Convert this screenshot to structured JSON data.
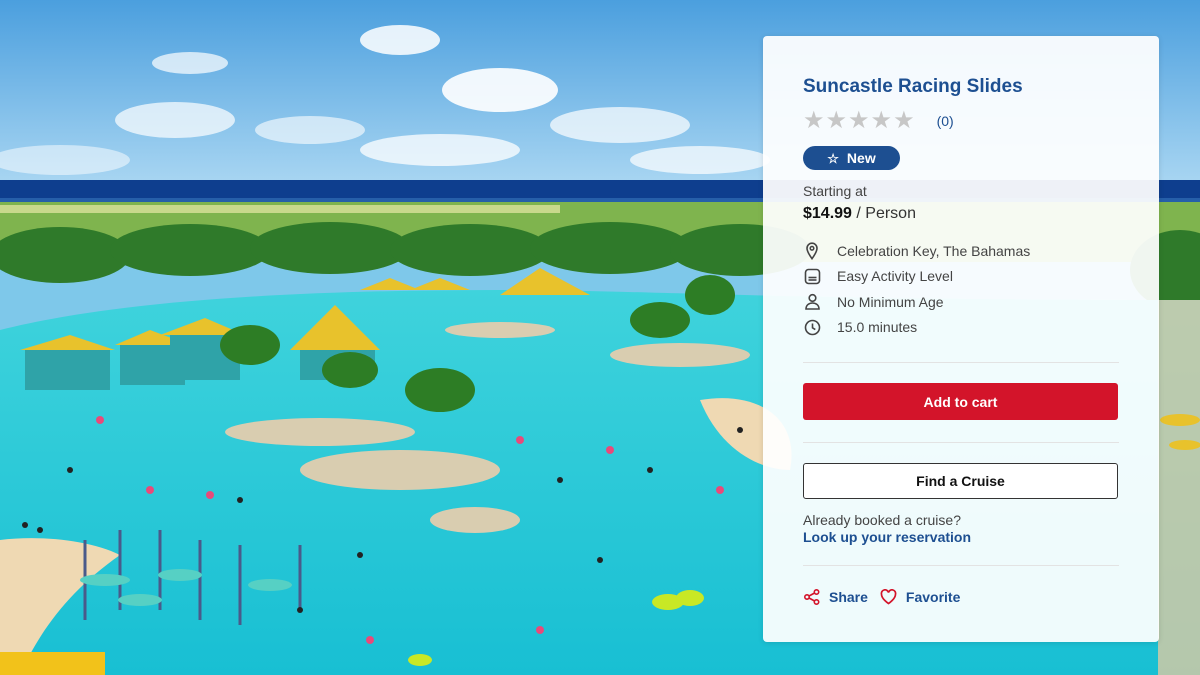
{
  "background": {
    "image": "resort-lagoon-image",
    "colors": {
      "sky": "#6fb6e6",
      "ocean": "#0d3a8a",
      "lagoon": "#2cc9d6",
      "sand": "#efd9b3"
    }
  },
  "card": {
    "title": "Suncastle Racing Slides",
    "rating": {
      "stars_filled": 0,
      "stars_total": 5,
      "count_label": "(0)"
    },
    "badge": {
      "label": "New",
      "icon": "star-outline-icon"
    },
    "starting_label": "Starting at",
    "price": {
      "amount": "$14.99",
      "unit": "/ Person"
    },
    "details": [
      {
        "icon": "location-pin-icon",
        "text": "Celebration Key, The Bahamas"
      },
      {
        "icon": "activity-level-icon",
        "text": "Easy Activity Level"
      },
      {
        "icon": "person-icon",
        "text": "No Minimum Age"
      },
      {
        "icon": "clock-icon",
        "text": "15.0 minutes"
      }
    ],
    "add_to_cart_label": "Add to cart",
    "find_cruise_label": "Find a Cruise",
    "booked_question": "Already booked a cruise?",
    "lookup_link": "Look up your reservation",
    "share_label": "Share",
    "favorite_label": "Favorite",
    "colors": {
      "brand_blue": "#1d4f91",
      "cta_red": "#d3142a",
      "star_empty": "#c7c7c7"
    }
  }
}
